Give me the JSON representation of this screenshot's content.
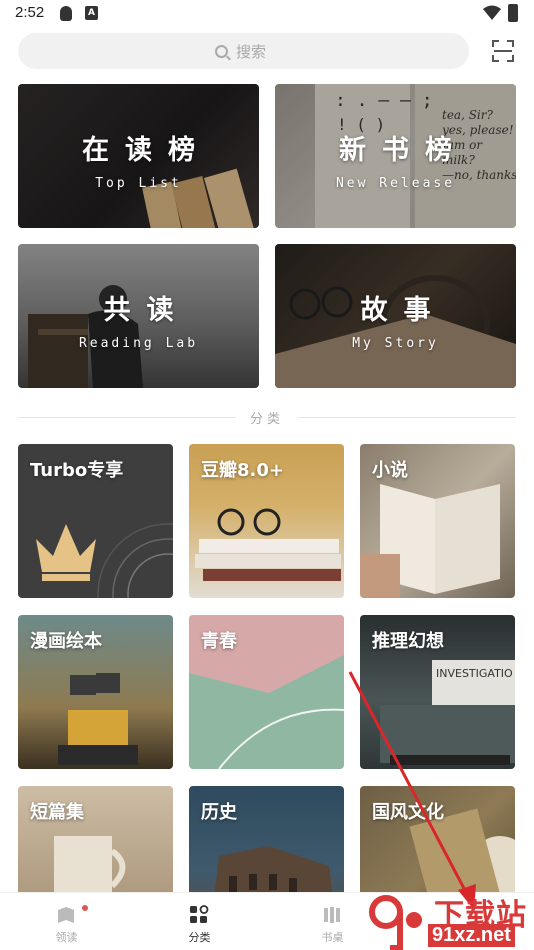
{
  "status_bar": {
    "time": "2:52",
    "a_badge": "A"
  },
  "search": {
    "placeholder": "搜索"
  },
  "featured": [
    {
      "title": "在读榜",
      "subtitle": "Top List"
    },
    {
      "title": "新书榜",
      "subtitle": "New Release"
    },
    {
      "title": "共读",
      "subtitle": "Reading Lab"
    },
    {
      "title": "故事",
      "subtitle": "My Story"
    }
  ],
  "section_title": "分类",
  "categories": [
    {
      "label": "Turbo专享"
    },
    {
      "label": "豆瓣8.0+"
    },
    {
      "label": "小说"
    },
    {
      "label": "漫画绘本"
    },
    {
      "label": "青春"
    },
    {
      "label": "推理幻想"
    },
    {
      "label": "短篇集"
    },
    {
      "label": "历史"
    },
    {
      "label": "国风文化"
    }
  ],
  "tabs": [
    {
      "label": "领读"
    },
    {
      "label": "分类"
    },
    {
      "label": "书桌"
    }
  ],
  "card_text": {
    "new_release_book": "tea, Sir?\nyes, please!\nJam or\nmilk?\n—no, thanks.",
    "typewriter_paper": "INVESTIGATIO"
  },
  "watermark": {
    "line1": "下载站",
    "line2": "91xz.net"
  },
  "colors": {
    "accent_red": "#e0554f",
    "annotation_red": "#d9262b"
  }
}
